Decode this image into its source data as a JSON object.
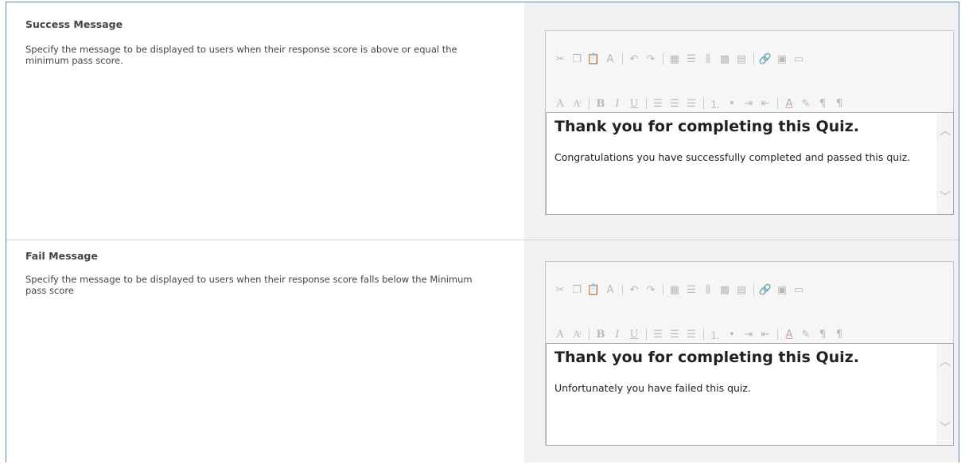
{
  "sections": [
    {
      "title": "Success Message",
      "description": "Specify the message to be displayed to users when their response score is above or equal the minimum pass score.",
      "editor": {
        "heading": "Thank you for completing this Quiz.",
        "body": "Congratulations you have successfully completed and passed this quiz."
      }
    },
    {
      "title": "Fail Message",
      "description": "Specify the message to be displayed to users when their response score falls below the Minimum pass score",
      "editor": {
        "heading": "Thank you for completing this Quiz.",
        "body": "Unfortunately you have failed this quiz."
      }
    }
  ],
  "toolbar": {
    "row1_icons": [
      "cut-icon",
      "copy-icon",
      "paste-icon",
      "spellcheck-icon",
      "undo-icon",
      "redo-icon",
      "table-icon",
      "insert-row-icon",
      "insert-column-icon",
      "grid-icon",
      "table-properties-icon",
      "link-icon",
      "image-icon",
      "insert-field-icon"
    ],
    "row2_icons": [
      "font-icon",
      "font-size-icon",
      "bold-icon",
      "italic-icon",
      "underline-icon",
      "align-left-icon",
      "align-center-icon",
      "align-right-icon",
      "numbered-list-icon",
      "bullet-list-icon",
      "indent-icon",
      "outdent-icon",
      "font-color-icon",
      "highlight-icon",
      "ltr-icon",
      "rtl-icon"
    ]
  },
  "colors": {
    "frame_border": "#5b84c0",
    "right_panel": "#f1f1f1",
    "disabled_icon": "#b9b9b9"
  }
}
